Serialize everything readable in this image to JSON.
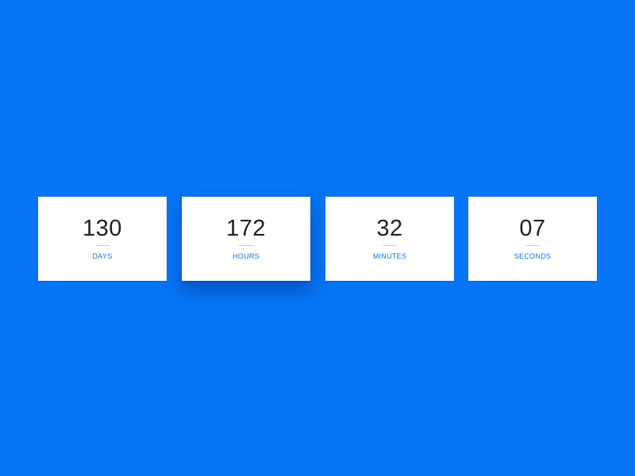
{
  "countdown": {
    "units": [
      {
        "value": "130",
        "label": "DAYS"
      },
      {
        "value": "172",
        "label": "HOURS"
      },
      {
        "value": "32",
        "label": "MINUTES"
      },
      {
        "value": "07",
        "label": "SECONDS"
      }
    ]
  },
  "colors": {
    "background": "#0775f5",
    "card": "#ffffff",
    "value_text": "#1f2024",
    "label_text": "#0d73e3",
    "divider": "#c9c9c9"
  }
}
